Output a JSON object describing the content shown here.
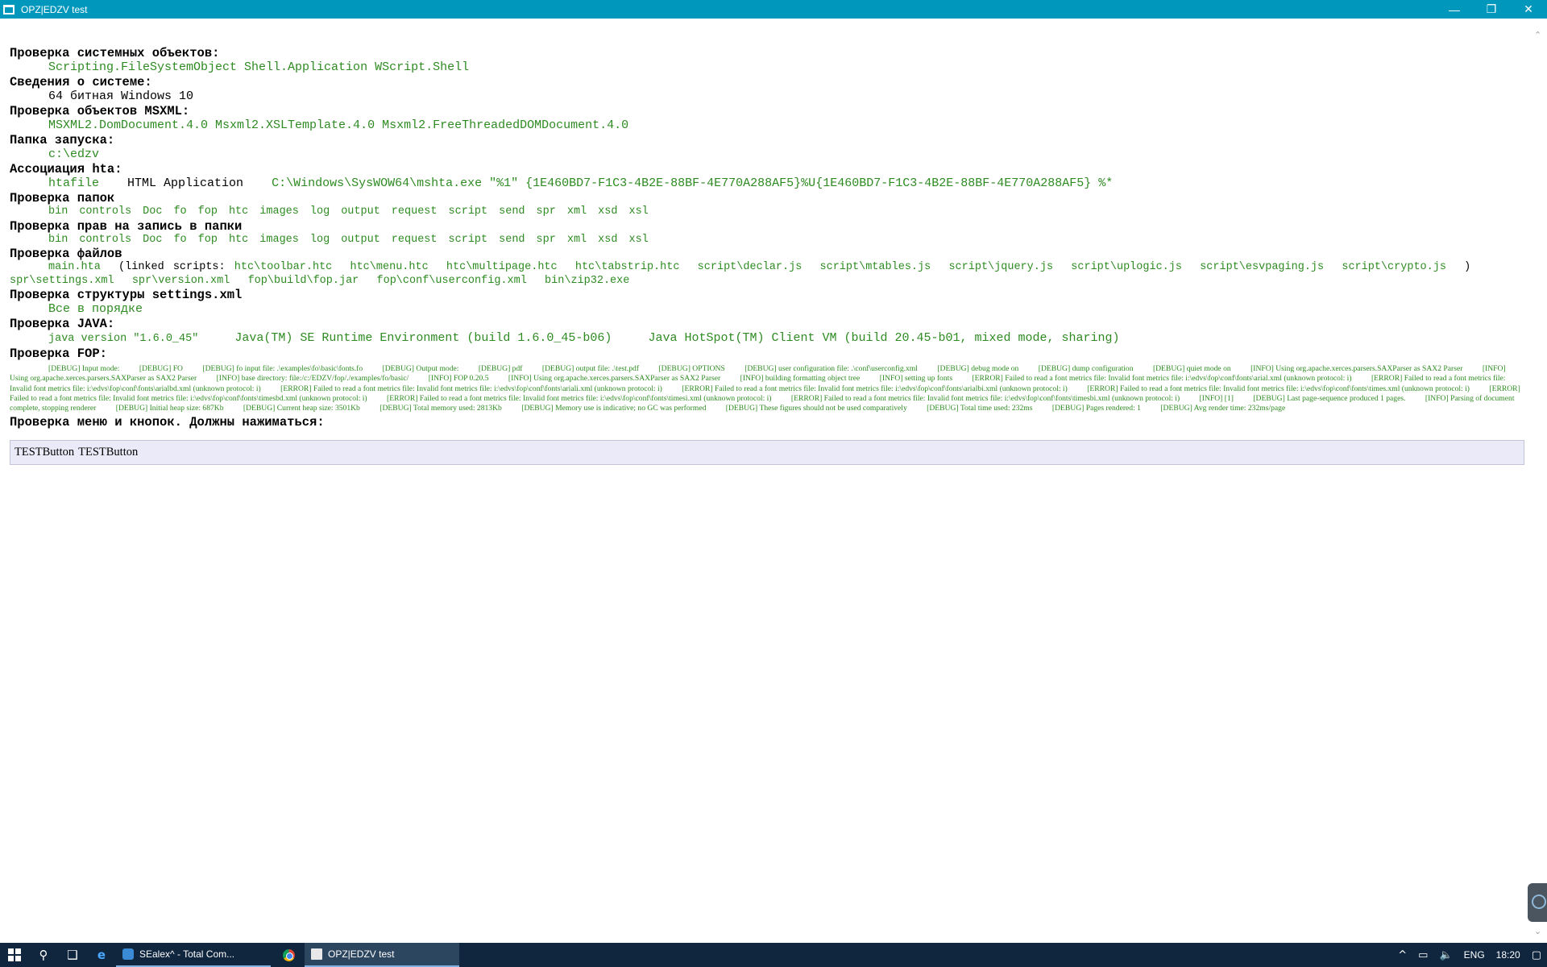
{
  "window": {
    "title": "OPZ|EDZV test",
    "minimize_glyph": "—",
    "restore_glyph": "❐",
    "close_glyph": "✕"
  },
  "sections": {
    "system_objects": {
      "heading": "Проверка системных объектов:",
      "value": "Scripting.FileSystemObject Shell.Application WScript.Shell"
    },
    "system_info": {
      "heading": "Сведения о системе:",
      "value": "64 битная Windows 10"
    },
    "msxml": {
      "heading": "Проверка объектов MSXML:",
      "value": "MSXML2.DomDocument.4.0 Msxml2.XSLTemplate.4.0 Msxml2.FreeThreadedDOMDocument.4.0"
    },
    "launch_folder": {
      "heading": "Папка запуска:",
      "value": "c:\\edzv"
    },
    "hta_assoc": {
      "heading": "Ассоциация hta:",
      "type": "htafile",
      "name": "HTML Application",
      "command": "C:\\Windows\\SysWOW64\\mshta.exe \"%1\" {1E460BD7-F1C3-4B2E-88BF-4E770A288AF5}%U{1E460BD7-F1C3-4B2E-88BF-4E770A288AF5} %*"
    },
    "folders": {
      "heading": "Проверка папок",
      "items": [
        "bin",
        "controls",
        "Doc",
        "fo",
        "fop",
        "htc",
        "images",
        "log",
        "output",
        "request",
        "script",
        "send",
        "spr",
        "xml",
        "xsd",
        "xsl"
      ]
    },
    "write_rights": {
      "heading": "Проверка прав на запись в папки",
      "items": [
        "bin",
        "controls",
        "Doc",
        "fo",
        "fop",
        "htc",
        "images",
        "log",
        "output",
        "request",
        "script",
        "send",
        "spr",
        "xml",
        "xsd",
        "xsl"
      ]
    },
    "files": {
      "heading": "Проверка файлов",
      "main": "main.hta",
      "linked_open": "(linked scripts:",
      "linked_scripts": [
        "htc\\toolbar.htc",
        "htc\\menu.htc",
        "htc\\multipage.htc",
        "htc\\tabstrip.htc",
        "script\\declar.js",
        "script\\mtables.js",
        "script\\jquery.js",
        "script\\uplogic.js",
        "script\\esvpaging.js",
        "script\\crypto.js"
      ],
      "linked_close": ")",
      "other_files": [
        "spr\\settings.xml",
        "spr\\version.xml",
        "fop\\build\\fop.jar",
        "fop\\conf\\userconfig.xml",
        "bin\\zip32.exe"
      ]
    },
    "settings": {
      "heading": "Проверка структуры settings.xml",
      "value": "Все в порядке"
    },
    "java": {
      "heading": "Проверка JAVA:",
      "version": "java version \"1.6.0_45\"",
      "runtime": "Java(TM) SE Runtime Environment (build 1.6.0_45-b06)",
      "vm": "Java HotSpot(TM) Client VM (build 20.45-b01, mixed mode, sharing)"
    },
    "fop": {
      "heading": "Проверка FOP:",
      "log": [
        "[DEBUG] Input mode:",
        "[DEBUG] FO",
        "[DEBUG] fo input file: .\\examples\\fo\\basic\\fonts.fo",
        "[DEBUG] Output mode:",
        "[DEBUG] pdf",
        "[DEBUG] output file: .\\test.pdf",
        "[DEBUG] OPTIONS",
        "[DEBUG] user configuration file: .\\conf\\userconfig.xml",
        "[DEBUG] debug mode on",
        "[DEBUG] dump configuration",
        "[DEBUG] quiet mode on",
        "[INFO] Using org.apache.xerces.parsers.SAXParser as SAX2 Parser",
        "[INFO] Using org.apache.xerces.parsers.SAXParser as SAX2 Parser",
        "[INFO] base directory: file:/c:/EDZV/fop/./examples/fo/basic/",
        "[INFO] FOP 0.20.5",
        "[INFO] Using org.apache.xerces.parsers.SAXParser as SAX2 Parser",
        "[INFO] building formatting object tree",
        "[INFO] setting up fonts",
        "[ERROR] Failed to read a font metrics file: Invalid font metrics file: i:\\edvs\\fop\\conf\\fonts\\arial.xml (unknown protocol: i)",
        "[ERROR] Failed to read a font metrics file: Invalid font metrics file: i:\\edvs\\fop\\conf\\fonts\\arialbd.xml (unknown protocol: i)",
        "[ERROR] Failed to read a font metrics file: Invalid font metrics file: i:\\edvs\\fop\\conf\\fonts\\ariali.xml (unknown protocol: i)",
        "[ERROR] Failed to read a font metrics file: Invalid font metrics file: i:\\edvs\\fop\\conf\\fonts\\arialbi.xml (unknown protocol: i)",
        "[ERROR] Failed to read a font metrics file: Invalid font metrics file: i:\\edvs\\fop\\conf\\fonts\\times.xml (unknown protocol: i)",
        "[ERROR] Failed to read a font metrics file: Invalid font metrics file: i:\\edvs\\fop\\conf\\fonts\\timesbd.xml (unknown protocol: i)",
        "[ERROR] Failed to read a font metrics file: Invalid font metrics file: i:\\edvs\\fop\\conf\\fonts\\timesi.xml (unknown protocol: i)",
        "[ERROR] Failed to read a font metrics file: Invalid font metrics file: i:\\edvs\\fop\\conf\\fonts\\timesbi.xml (unknown protocol: i)",
        "[INFO] [1]",
        "[DEBUG] Last page-sequence produced 1 pages.",
        "[INFO] Parsing of document complete, stopping renderer",
        "[DEBUG] Initial heap size: 687Kb",
        "[DEBUG] Current heap size: 3501Kb",
        "[DEBUG] Total memory used: 2813Kb",
        "[DEBUG] Memory use is indicative; no GC was performed",
        "[DEBUG] These figures should not be used comparatively",
        "[DEBUG] Total time used: 232ms",
        "[DEBUG] Pages rendered: 1",
        "[DEBUG] Avg render time: 232ms/page"
      ]
    },
    "menu": {
      "heading": "Проверка меню и кнопок. Должны нажиматься:",
      "buttons": [
        "TESTButton",
        "TESTButton"
      ]
    }
  },
  "taskbar": {
    "apps": [
      {
        "label": "SEalex^ - Total Com...",
        "active": false
      },
      {
        "label": "OPZ|EDZV test",
        "active": true
      }
    ],
    "tray": {
      "language": "ENG",
      "time": "18:20"
    }
  },
  "colors": {
    "titlebar": "#0097bd",
    "value_text": "#2e8b22",
    "taskbar": "#10263f",
    "button_bar": "#eaeaf8"
  }
}
